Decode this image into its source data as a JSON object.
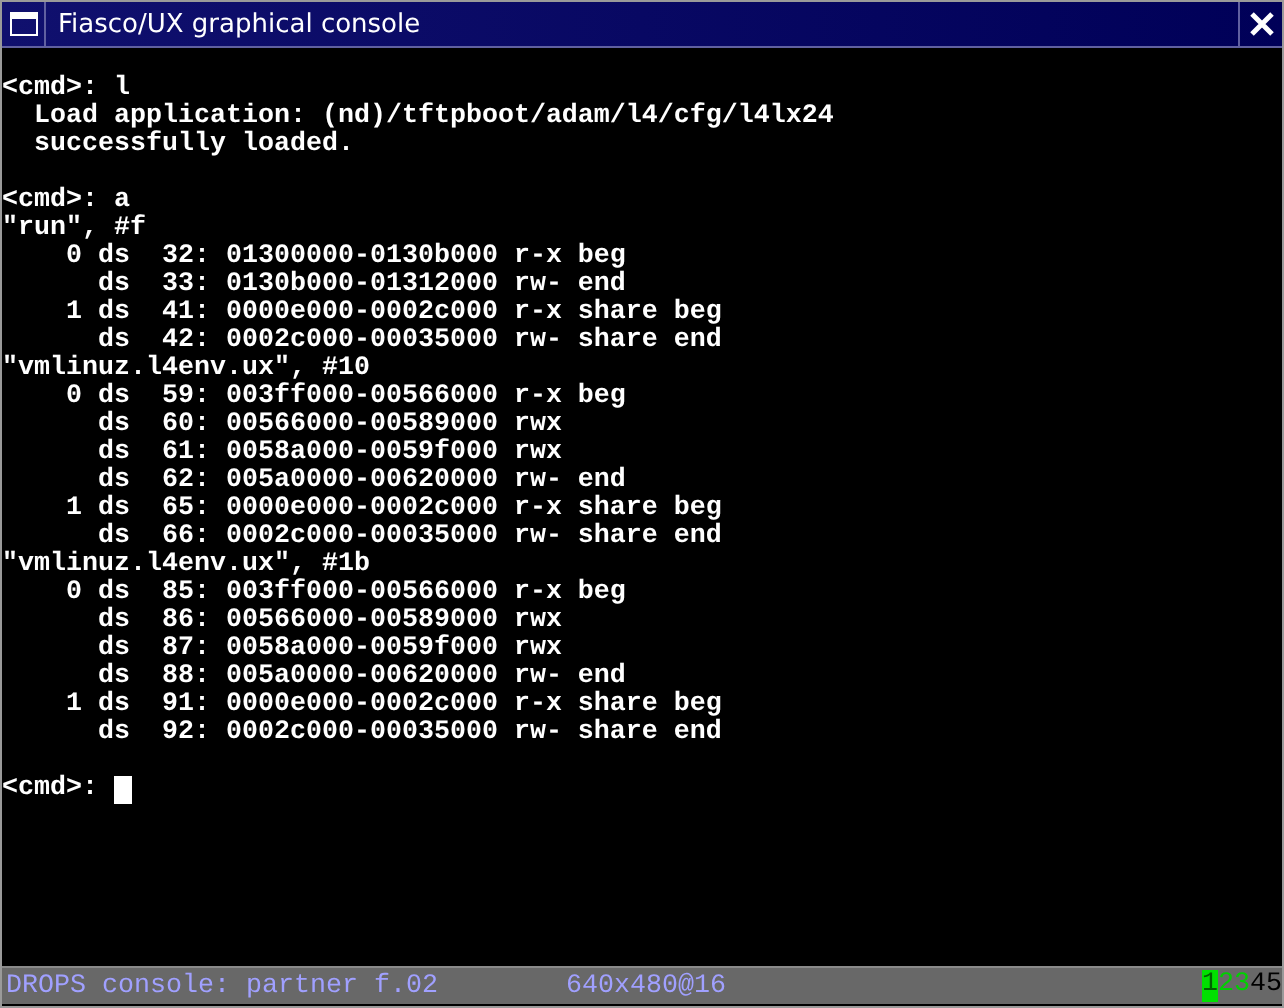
{
  "window": {
    "title": "Fiasco/UX graphical console"
  },
  "console": {
    "blocks": [
      {
        "lines": [
          "<cmd>: l",
          "  Load application: (nd)/tftpboot/adam/l4/cfg/l4lx24",
          "  successfully loaded."
        ]
      },
      {
        "lines": [
          "<cmd>: a",
          "\"run\", #f",
          "    0 ds  32: 01300000-0130b000 r-x beg",
          "      ds  33: 0130b000-01312000 rw- end",
          "    1 ds  41: 0000e000-0002c000 r-x share beg",
          "      ds  42: 0002c000-00035000 rw- share end",
          "\"vmlinuz.l4env.ux\", #10",
          "    0 ds  59: 003ff000-00566000 r-x beg",
          "      ds  60: 00566000-00589000 rwx",
          "      ds  61: 0058a000-0059f000 rwx",
          "      ds  62: 005a0000-00620000 rw- end",
          "    1 ds  65: 0000e000-0002c000 r-x share beg",
          "      ds  66: 0002c000-00035000 rw- share end",
          "\"vmlinuz.l4env.ux\", #1b",
          "    0 ds  85: 003ff000-00566000 r-x beg",
          "      ds  86: 00566000-00589000 rwx",
          "      ds  87: 0058a000-0059f000 rwx",
          "      ds  88: 005a0000-00620000 rw- end",
          "    1 ds  91: 0000e000-0002c000 r-x share beg",
          "      ds  92: 0002c000-00035000 rw- share end"
        ]
      }
    ],
    "prompt": "<cmd>: ",
    "cursor": true
  },
  "status_bar": {
    "label": "DROPS console: partner f.02",
    "mode": "640x480@16",
    "consoles": [
      {
        "label": "1",
        "selected": true,
        "active": true
      },
      {
        "label": "2",
        "selected": false,
        "active": true
      },
      {
        "label": "3",
        "selected": false,
        "active": true
      },
      {
        "label": "4",
        "selected": false,
        "active": false
      },
      {
        "label": "5",
        "selected": false,
        "active": false
      }
    ]
  }
}
